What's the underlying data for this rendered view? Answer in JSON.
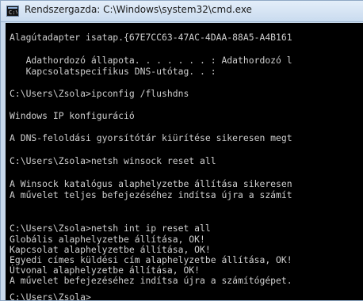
{
  "window": {
    "icon": "command-prompt-icon",
    "title": "Rendszergazda: C:\\Windows\\system32\\cmd.exe"
  },
  "console": {
    "lines": [
      "Alagútadapter isatap.{67E7CC63-47AC-4DAA-88A5-A4B161",
      "   Adathordozó állapota. . . . . . . : Adathordozó l",
      "   Kapcsolatspecifikus DNS-utótag. . :",
      "C:\\Users\\Zsola>ipconfig /flushdns",
      "Windows IP konfiguráció",
      "A DNS-feloldási gyorsítótár kiürítése sikeresen megt",
      "C:\\Users\\Zsola>netsh winsock reset all",
      "A Winsock katalógus alaphelyzetbe állítása sikeresen",
      "A művelet teljes befejezéséhez indítsa újra a számít",
      "C:\\Users\\Zsola>netsh int ip reset all",
      "Globális alaphelyzetbe állítása, OK!",
      "Kapcsolat alaphelyzetbe állítása, OK!",
      "Egyedi címes küldési cím alaphelyzetbe állítása, OK!",
      "Útvonal alaphelyzetbe állítása, OK!",
      "A művelet befejezéséhez indítsa újra a számítógépet.",
      "C:\\Users\\Zsola>"
    ]
  }
}
